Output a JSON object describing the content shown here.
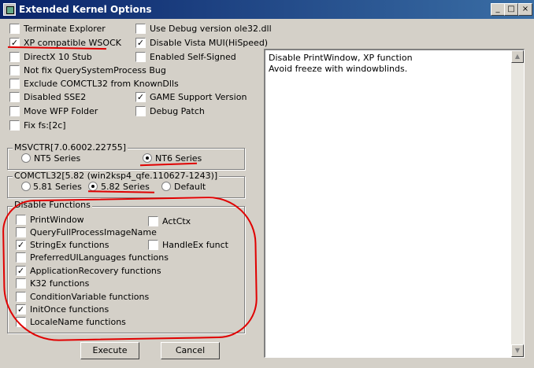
{
  "window": {
    "title": "Extended Kernel Options",
    "min": "_",
    "max": "□",
    "close": "×"
  },
  "options_col1": [
    {
      "label": "Terminate Explorer",
      "checked": false
    },
    {
      "label": "XP compatible WSOCK",
      "checked": true
    },
    {
      "label": "DirectX 10 Stub",
      "checked": false
    },
    {
      "label": "Not fix QuerySystemProcess Bug",
      "checked": false
    },
    {
      "label": "Exclude COMCTL32 from KnownDlls",
      "checked": false
    },
    {
      "label": "Disabled SSE2",
      "checked": false
    },
    {
      "label": "Move WFP Folder",
      "checked": false
    },
    {
      "label": "Fix fs:[2c]",
      "checked": false
    }
  ],
  "options_col2": [
    {
      "label": "Use Debug version ole32.dll",
      "checked": false
    },
    {
      "label": "Disable Vista MUI(HiSpeed)",
      "checked": true
    },
    {
      "label": "Enabled Self-Signed",
      "checked": false
    },
    {
      "label": "GAME Support Version",
      "checked": true
    },
    {
      "label": "Debug Patch",
      "checked": false
    }
  ],
  "msvctr": {
    "title": "MSVCTR[7.0.6002.22755]",
    "options": [
      {
        "label": "NT5 Series",
        "selected": false
      },
      {
        "label": "NT6 Series",
        "selected": true
      }
    ]
  },
  "comctl": {
    "title": "COMCTL32[5.82 (win2ksp4_qfe.110627-1243)]",
    "options": [
      {
        "label": "5.81 Series",
        "selected": false
      },
      {
        "label": "5.82 Series",
        "selected": true
      },
      {
        "label": "Default",
        "selected": false
      }
    ]
  },
  "disable_functions": {
    "title": "Disable Functions",
    "col1": [
      {
        "label": "PrintWindow",
        "checked": false
      },
      {
        "label": "QueryFullProcessImageName",
        "checked": false
      },
      {
        "label": "StringEx functions",
        "checked": true
      },
      {
        "label": "PreferredUILanguages functions",
        "checked": false
      },
      {
        "label": "ApplicationRecovery functions",
        "checked": true
      },
      {
        "label": "K32 functions",
        "checked": false
      },
      {
        "label": "ConditionVariable functions",
        "checked": false
      },
      {
        "label": "InitOnce functions",
        "checked": true
      },
      {
        "label": "LocaleName functions",
        "checked": false
      }
    ],
    "col2": [
      {
        "label": "ActCtx",
        "checked": false
      },
      {
        "label": "HandleEx funct",
        "checked": false
      }
    ]
  },
  "memo": {
    "line1": "Disable PrintWindow, XP function",
    "line2": "Avoid freeze with windowblinds."
  },
  "buttons": {
    "execute": "Execute",
    "cancel": "Cancel"
  },
  "check_mark": "✓",
  "annotation_color": "#e00000"
}
